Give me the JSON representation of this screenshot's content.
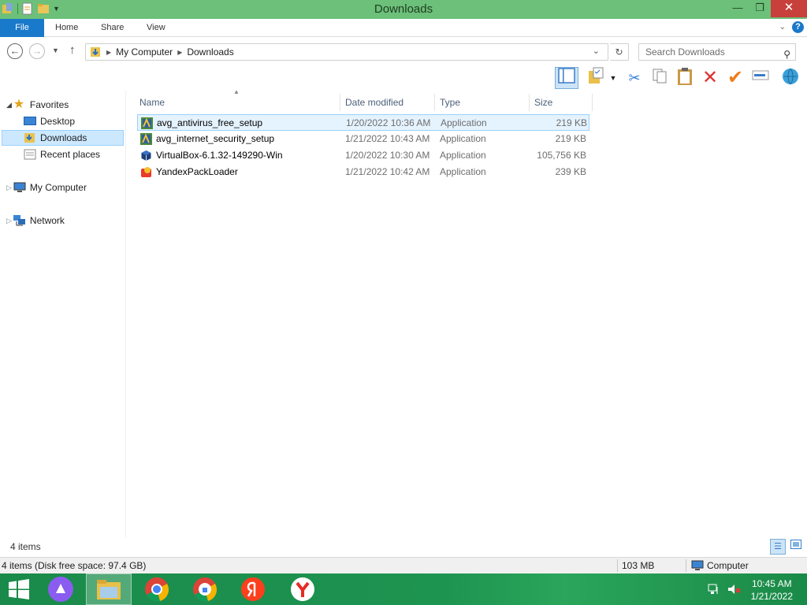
{
  "window": {
    "title": "Downloads"
  },
  "ribbon": {
    "tabs": [
      "File",
      "Home",
      "Share",
      "View"
    ]
  },
  "address": {
    "path": [
      "My Computer",
      "Downloads"
    ],
    "search_placeholder": "Search Downloads"
  },
  "sidebar": {
    "favorites_label": "Favorites",
    "favorites": [
      "Desktop",
      "Downloads",
      "Recent places"
    ],
    "my_computer": "My Computer",
    "network": "Network"
  },
  "columns": [
    "Name",
    "Date modified",
    "Type",
    "Size"
  ],
  "files": [
    {
      "name": "avg_antivirus_free_setup",
      "date": "1/20/2022 10:36 AM",
      "type": "Application",
      "size": "219 KB"
    },
    {
      "name": "avg_internet_security_setup",
      "date": "1/21/2022 10:43 AM",
      "type": "Application",
      "size": "219 KB"
    },
    {
      "name": "VirtualBox-6.1.32-149290-Win",
      "date": "1/20/2022 10:30 AM",
      "type": "Application",
      "size": "105,756 KB"
    },
    {
      "name": "YandexPackLoader",
      "date": "1/21/2022 10:42 AM",
      "type": "Application",
      "size": "239 KB"
    }
  ],
  "status": {
    "items": "4 items",
    "details": "4 items (Disk free space: 97.4 GB)",
    "size": "103 MB",
    "location": "Computer"
  },
  "taskbar": {
    "time": "10:45 AM",
    "date": "1/21/2022"
  }
}
